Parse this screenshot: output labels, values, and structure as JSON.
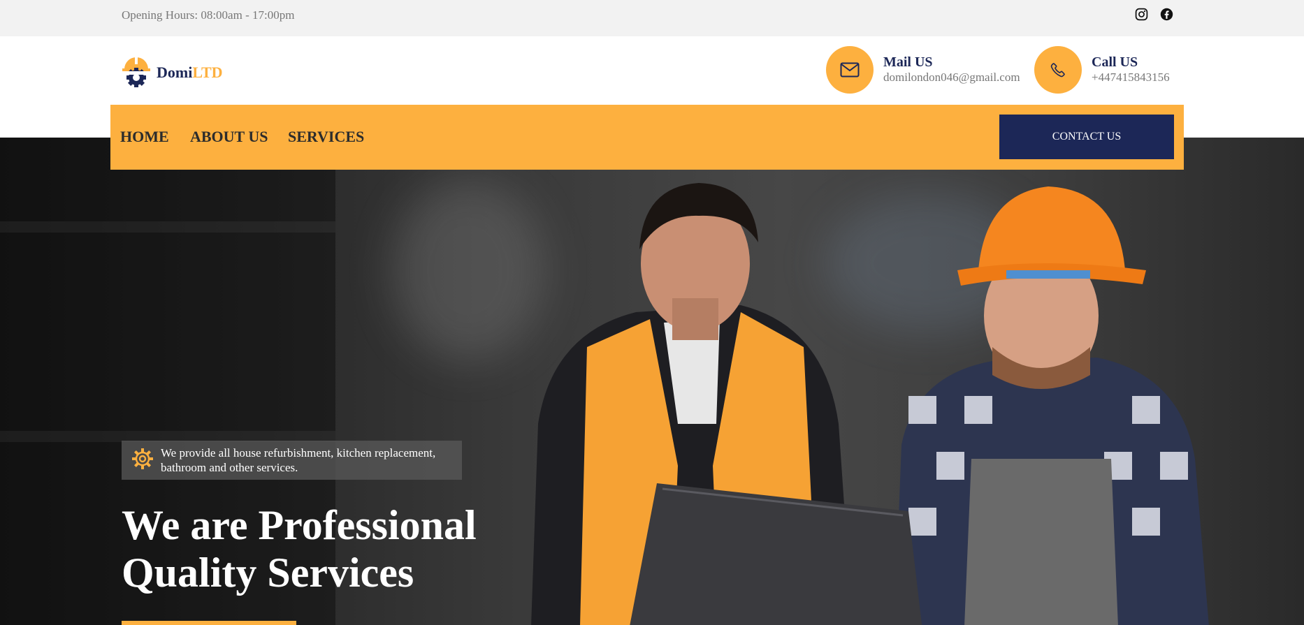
{
  "topbar": {
    "opening_hours": "Opening Hours: 08:00am - 17:00pm",
    "social": [
      {
        "icon": "instagram-icon"
      },
      {
        "icon": "facebook-icon"
      }
    ]
  },
  "header": {
    "logo": {
      "name_main": "Domi",
      "name_accent": "LTD",
      "icon": "helmet-gear-logo-icon"
    },
    "mail": {
      "title": "Mail US",
      "value": "domilondon046@gmail.com",
      "icon": "envelope-icon"
    },
    "call": {
      "title": "Call US",
      "value": "+447415843156",
      "icon": "phone-icon"
    }
  },
  "nav": {
    "items": [
      "HOME",
      "ABOUT US",
      "SERVICES"
    ],
    "contact_button": "CONTACT US"
  },
  "hero": {
    "tagline": "We provide all house refurbishment, kitchen replacement, bathroom and other services.",
    "headline_line1": "We are Professional",
    "headline_line2": "Quality Services"
  },
  "colors": {
    "accent": "#fdb03f",
    "navy": "#1c2757",
    "topbar_bg": "#f2f2f2",
    "muted_text": "#777777"
  }
}
